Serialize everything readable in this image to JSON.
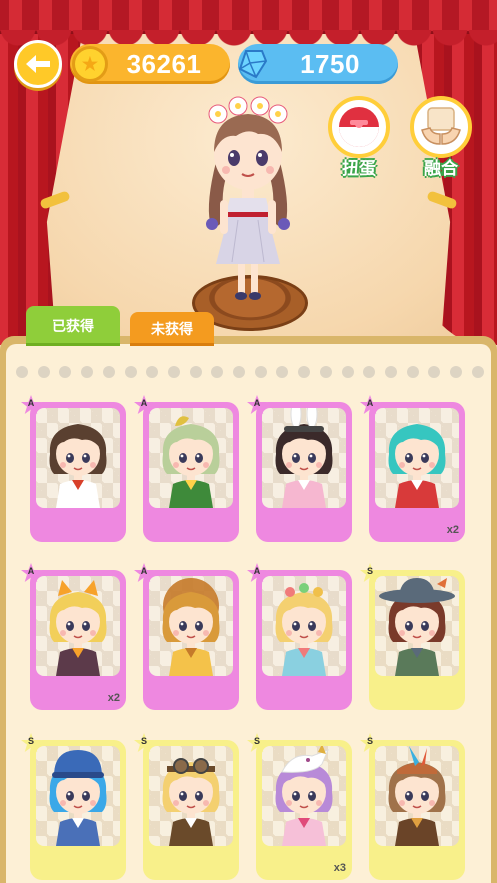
{
  "currency": {
    "coins": "36261",
    "gems": "1750"
  },
  "actions": {
    "gacha_label": "扭蛋",
    "fuse_label": "融合"
  },
  "tabs": {
    "obtained": "已获得",
    "not_obtained": "未获得"
  },
  "colors": {
    "rank_a": "#ee88e0",
    "rank_s": "#f8f08a",
    "tab_active": "#8fce3a",
    "tab_inactive": "#f49b1f",
    "coin_pill": "#fbb52d",
    "gem_pill": "#5bbdf2"
  },
  "cards": [
    {
      "rank": "A",
      "count": "",
      "hair": "#5a4030",
      "outfit": "#ffffff",
      "accent": "#d8402a",
      "hat": "none"
    },
    {
      "rank": "A",
      "count": "",
      "hair": "#b9cf9a",
      "outfit": "#3e8a3a",
      "accent": "#ffd24a",
      "hat": "leaf"
    },
    {
      "rank": "A",
      "count": "",
      "hair": "#3b2a2a",
      "outfit": "#f6b7d0",
      "accent": "#ffffff",
      "hat": "bunny"
    },
    {
      "rank": "A",
      "count": "x2",
      "hair": "#36c6c0",
      "outfit": "#d83a3a",
      "accent": "#ffffff",
      "hat": "none"
    },
    {
      "rank": "A",
      "count": "x2",
      "hair": "#f2cf5a",
      "outfit": "#5c3a4a",
      "accent": "#f7a22a",
      "hat": "ears"
    },
    {
      "rank": "A",
      "count": "",
      "hair": "#d99a3a",
      "outfit": "#f4c24a",
      "accent": "#c57a2a",
      "hat": "lion"
    },
    {
      "rank": "A",
      "count": "",
      "hair": "#f4d070",
      "outfit": "#8ad0e0",
      "accent": "#f07a7a",
      "hat": "balls"
    },
    {
      "rank": "S",
      "count": "",
      "hair": "#7a3a2a",
      "outfit": "#5a7a5a",
      "accent": "#5a6a7a",
      "hat": "cowboy"
    },
    {
      "rank": "S",
      "count": "",
      "hair": "#3aa8e8",
      "outfit": "#4a70b8",
      "accent": "#ffffff",
      "hat": "beanie"
    },
    {
      "rank": "S",
      "count": "",
      "hair": "#f4d070",
      "outfit": "#6a4a2a",
      "accent": "#ffffff",
      "hat": "goggles"
    },
    {
      "rank": "S",
      "count": "x3",
      "hair": "#b88ad8",
      "outfit": "#f6c0d8",
      "accent": "#e04a7a",
      "hat": "bird"
    },
    {
      "rank": "S",
      "count": "",
      "hair": "#a0724a",
      "outfit": "#6a4428",
      "accent": "#e0a040",
      "hat": "feather"
    }
  ]
}
